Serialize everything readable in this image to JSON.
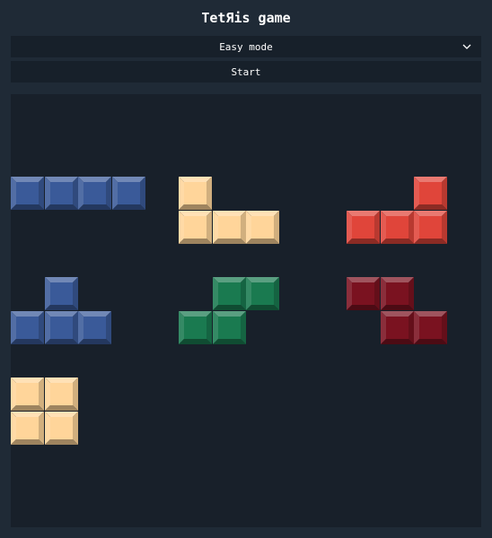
{
  "header": {
    "title": "TetЯis game"
  },
  "controls": {
    "mode_selected": "Easy mode",
    "start_label": "Start"
  },
  "colors": {
    "blue": "#3a5a99",
    "peach": "#ffd59a",
    "red": "#e0453a",
    "green": "#1a7a50",
    "maroon": "#7a1220"
  },
  "pieces": [
    {
      "name": "I",
      "color": "blue"
    },
    {
      "name": "L",
      "color": "peach"
    },
    {
      "name": "J",
      "color": "red"
    },
    {
      "name": "T",
      "color": "blue"
    },
    {
      "name": "S",
      "color": "green"
    },
    {
      "name": "Z",
      "color": "maroon"
    },
    {
      "name": "O",
      "color": "peach"
    }
  ]
}
